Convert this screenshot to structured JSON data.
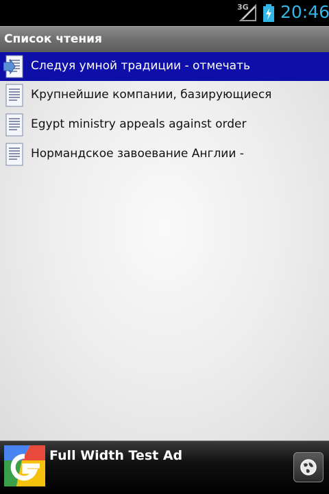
{
  "status_bar": {
    "network": "3G",
    "time": "20:46",
    "icons": [
      "signal-icon",
      "battery-charging-icon"
    ]
  },
  "title_bar": {
    "title": "Список чтения"
  },
  "reading_list": {
    "items": [
      {
        "title": "Следуя умной традиции - отмечать",
        "selected": true,
        "icon": "document-icon"
      },
      {
        "title": "Крупнейшие компании, базирующиеся",
        "selected": false,
        "icon": "document-icon"
      },
      {
        "title": "Egypt ministry appeals against order",
        "selected": false,
        "icon": "document-icon"
      },
      {
        "title": "Нормандское завоевание Англии -",
        "selected": false,
        "icon": "document-icon"
      }
    ]
  },
  "ad": {
    "text": "Full Width Test Ad",
    "icons": [
      "google-ad-logo-icon",
      "globe-icon"
    ]
  },
  "colors": {
    "status_accent": "#33b5e5",
    "selected_row": "#0e0ea8"
  }
}
